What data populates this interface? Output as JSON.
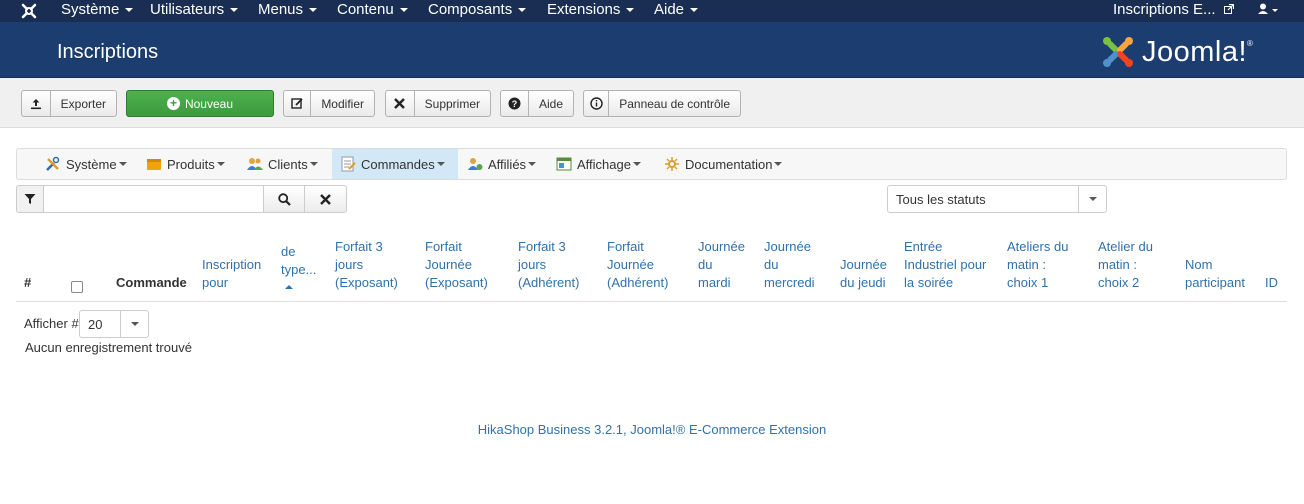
{
  "topnav": {
    "items": [
      "Système",
      "Utilisateurs",
      "Menus",
      "Contenu",
      "Composants",
      "Extensions",
      "Aide"
    ],
    "site_title": "Inscriptions E...",
    "icons": {
      "logo": "joomla-icon",
      "external": "external-link-icon",
      "user": "user-icon"
    }
  },
  "header": {
    "title": "Inscriptions",
    "brand": "Joomla!"
  },
  "toolbar": {
    "export_label": "Exporter",
    "new_label": "Nouveau",
    "edit_label": "Modifier",
    "delete_label": "Supprimer",
    "help_label": "Aide",
    "control_panel_label": "Panneau de contrôle"
  },
  "submenu": {
    "items": [
      "Système",
      "Produits",
      "Clients",
      "Commandes",
      "Affiliés",
      "Affichage",
      "Documentation"
    ],
    "active": "Commandes"
  },
  "filter": {
    "search_value": "",
    "status_value": "Tous les statuts"
  },
  "table": {
    "headers": {
      "num": "#",
      "order": "Commande",
      "registration": [
        "Inscription",
        "pour"
      ],
      "type": [
        "de",
        "type..."
      ],
      "forfait3_exp": [
        "Forfait 3",
        "jours",
        "(Exposant)"
      ],
      "forfait_day_exp": [
        "Forfait",
        "Journée",
        "(Exposant)"
      ],
      "forfait3_adh": [
        "Forfait 3",
        "jours",
        "(Adhérent)"
      ],
      "forfait_day_adh": [
        "Forfait",
        "Journée",
        "(Adhérent)"
      ],
      "tuesday": [
        "Journée",
        "du",
        "mardi"
      ],
      "wednesday": [
        "Journée",
        "du",
        "mercredi"
      ],
      "thursday": [
        "Journée",
        "du jeudi"
      ],
      "industrial": [
        "Entrée",
        "Industriel pour",
        "la soirée"
      ],
      "workshop1": [
        "Ateliers du",
        "matin :",
        "choix 1"
      ],
      "workshop2": [
        "Atelier du",
        "matin :",
        "choix 2"
      ],
      "participant": [
        "Nom",
        "participant"
      ],
      "id": "ID"
    }
  },
  "pagination": {
    "label": "Afficher #",
    "limit": "20"
  },
  "empty_message": "Aucun enregistrement trouvé",
  "footer": "HikaShop Business 3.2.1, Joomla!® E-Commerce Extension"
}
